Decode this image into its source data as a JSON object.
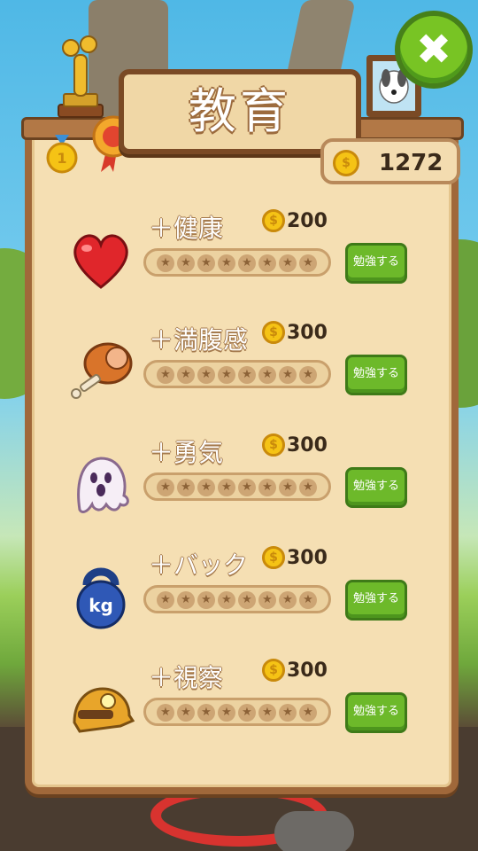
{
  "title": "教育",
  "balance": "1272",
  "close_icon": "close-x-icon",
  "skills": [
    {
      "name": "＋健康",
      "price": "200",
      "button": "勉強する",
      "icon": "heart-icon",
      "stars_filled": 0,
      "stars_total": 8
    },
    {
      "name": "＋満腹感",
      "price": "300",
      "button": "勉強する",
      "icon": "ham-leg-icon",
      "stars_filled": 0,
      "stars_total": 8
    },
    {
      "name": "＋勇気",
      "price": "300",
      "button": "勉強する",
      "icon": "ghost-icon",
      "stars_filled": 0,
      "stars_total": 8
    },
    {
      "name": "＋バック",
      "price": "300",
      "button": "勉強する",
      "icon": "kettlebell-icon",
      "stars_filled": 0,
      "stars_total": 8
    },
    {
      "name": "＋視察",
      "price": "300",
      "button": "勉強する",
      "icon": "miner-helmet-icon",
      "stars_filled": 0,
      "stars_total": 8
    }
  ],
  "medal_rank": "1",
  "kettlebell_label": "kg",
  "colors": {
    "accent_green": "#6db92a",
    "panel": "#f5dfb3",
    "coin": "#f5c315"
  }
}
